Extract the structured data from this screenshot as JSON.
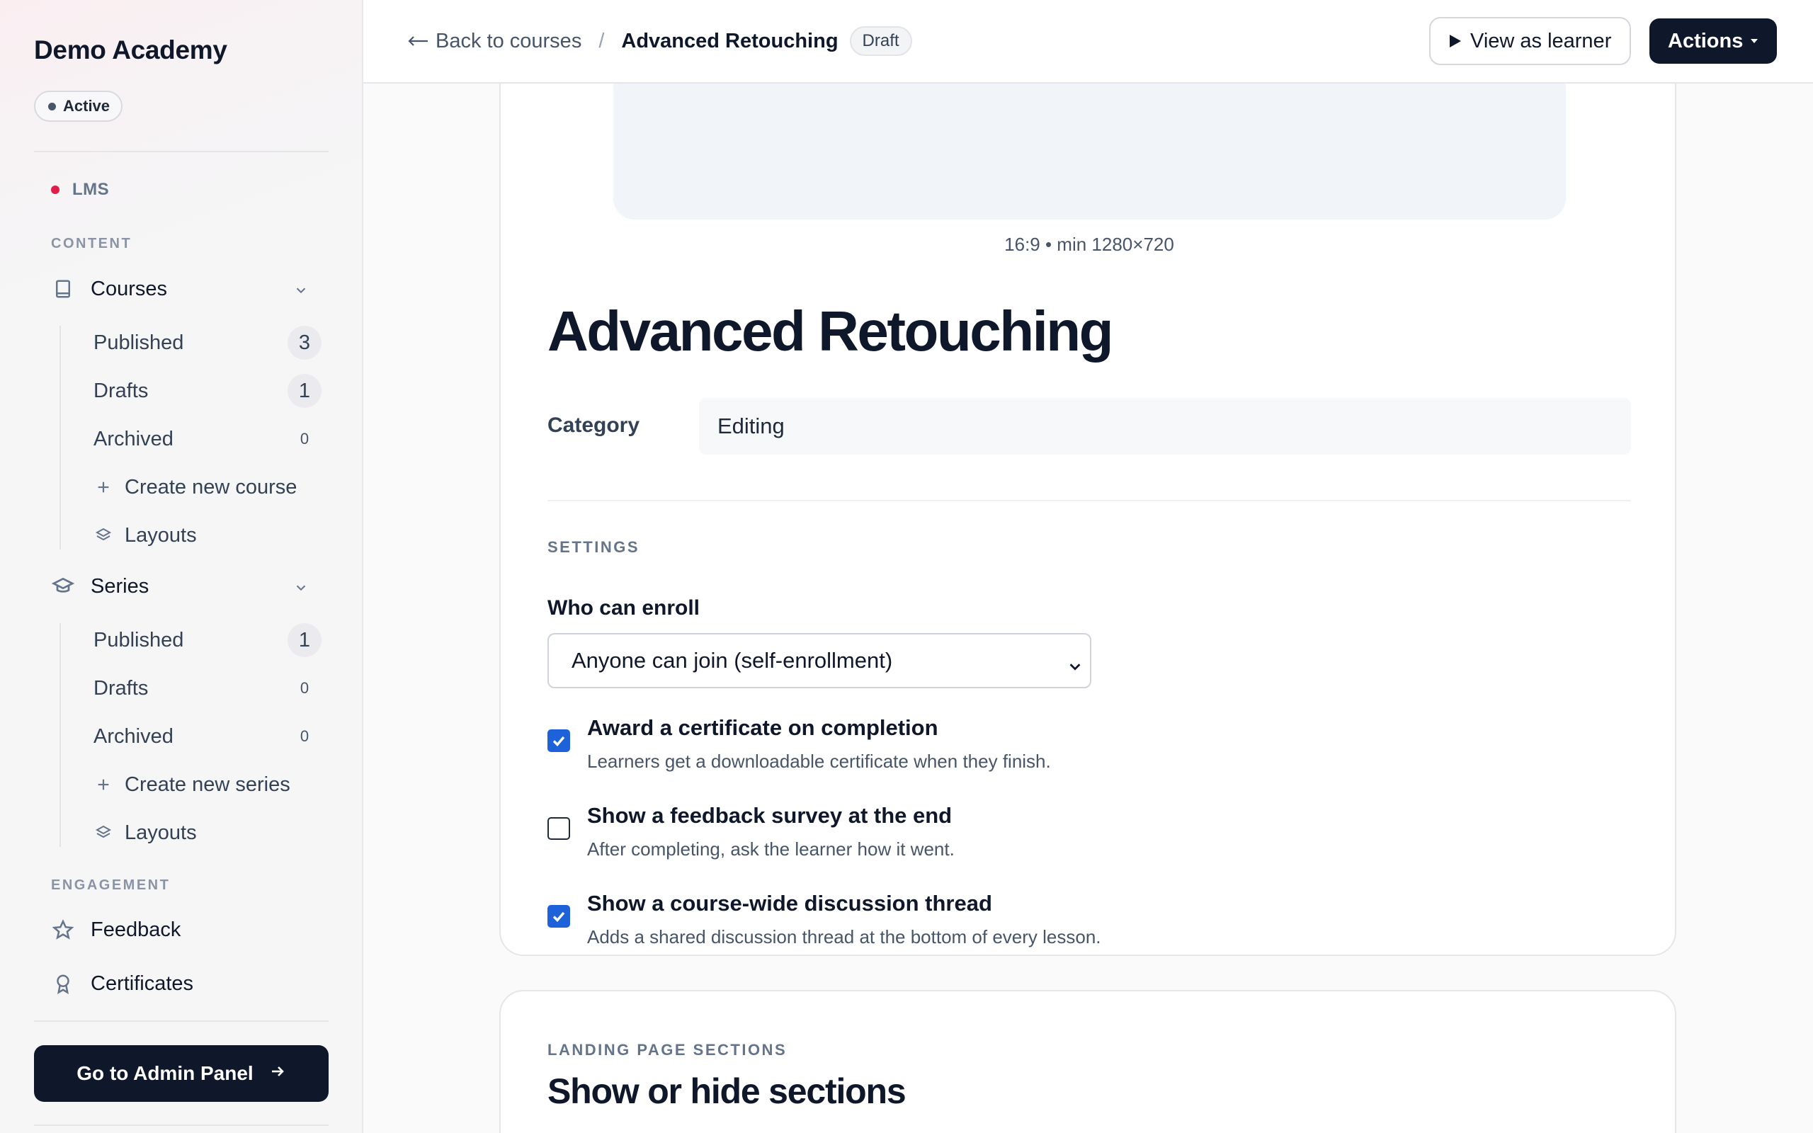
{
  "sidebar": {
    "brand": "Demo Academy",
    "status": "Active",
    "app_label": "LMS",
    "content_section": "CONTENT",
    "courses": {
      "label": "Courses",
      "items": [
        {
          "label": "Published",
          "count": "3"
        },
        {
          "label": "Drafts",
          "count": "1"
        },
        {
          "label": "Archived",
          "count": "0"
        }
      ],
      "create": "Create new course",
      "layouts": "Layouts"
    },
    "series": {
      "label": "Series",
      "items": [
        {
          "label": "Published",
          "count": "1"
        },
        {
          "label": "Drafts",
          "count": "0"
        },
        {
          "label": "Archived",
          "count": "0"
        }
      ],
      "create": "Create new series",
      "layouts": "Layouts"
    },
    "engagement_section": "ENGAGEMENT",
    "engagement_items": [
      {
        "label": "Feedback",
        "icon": "star-icon"
      },
      {
        "label": "Certificates",
        "icon": "award-icon"
      }
    ],
    "admin_button": "Go to Admin Panel"
  },
  "topbar": {
    "back_label": "Back to courses",
    "separator": "/",
    "current": "Advanced Retouching",
    "badge": "Draft",
    "view_button": "View as learner",
    "actions_button": "Actions"
  },
  "course": {
    "image_hint": "16:9 • min 1280×720",
    "title": "Advanced Retouching",
    "category_label": "Category",
    "category_value": "Editing",
    "settings_label": "SETTINGS",
    "enroll_label": "Who can enroll",
    "enroll_value": "Anyone can join (self-enrollment)",
    "options": [
      {
        "title": "Award a certificate on completion",
        "desc": "Learners get a downloadable certificate when they finish.",
        "checked": true
      },
      {
        "title": "Show a feedback survey at the end",
        "desc": "After completing, ask the learner how it went.",
        "checked": false
      },
      {
        "title": "Show a course-wide discussion thread",
        "desc": "Adds a shared discussion thread at the bottom of every lesson.",
        "checked": true
      }
    ]
  },
  "landing": {
    "label": "LANDING PAGE SECTIONS",
    "title": "Show or hide sections"
  },
  "colors": {
    "primary": "#0f172a",
    "accent_dot": "#e11d48",
    "checkbox": "#1d62d8"
  }
}
